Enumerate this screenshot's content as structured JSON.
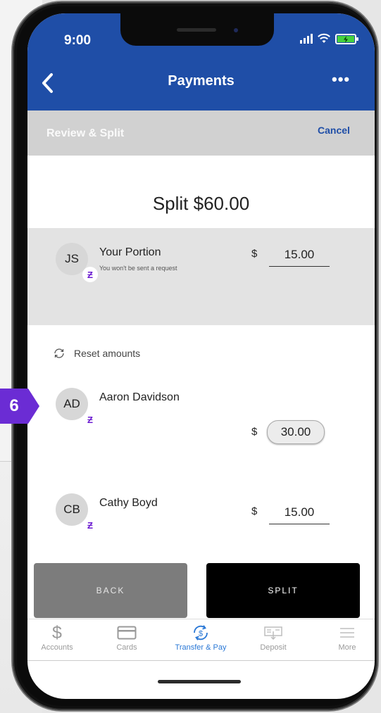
{
  "status_bar": {
    "time": "9:00"
  },
  "nav": {
    "title": "Payments",
    "more": "•••"
  },
  "subheader": {
    "step": "Review & Split",
    "cancel": "Cancel"
  },
  "split_title": "Split $60.00",
  "your_portion": {
    "initials": "JS",
    "name": "Your Portion",
    "note": "You won't be sent a request",
    "currency": "$",
    "amount": "15.00"
  },
  "reset_label": "Reset amounts",
  "recipients": [
    {
      "initials": "AD",
      "name": "Aaron Davidson",
      "currency": "$",
      "amount": "30.00"
    },
    {
      "initials": "CB",
      "name": "Cathy Boyd",
      "currency": "$",
      "amount": "15.00"
    }
  ],
  "zelle_glyph": "Ƶ",
  "buttons": {
    "back": "BACK",
    "split": "SPLIT"
  },
  "tabs": [
    {
      "label": "Accounts",
      "icon": "dollar-icon"
    },
    {
      "label": "Cards",
      "icon": "card-icon"
    },
    {
      "label": "Transfer & Pay",
      "icon": "transfer-pay-icon",
      "active": true
    },
    {
      "label": "Deposit",
      "icon": "check-deposit-icon"
    },
    {
      "label": "More",
      "icon": "menu-icon"
    }
  ],
  "step_marker": "6",
  "colors": {
    "brand_blue": "#1f4ea7",
    "zelle_purple": "#6c1cd1",
    "active_tab": "#2a78d6",
    "marker_purple": "#6b2cd4"
  }
}
